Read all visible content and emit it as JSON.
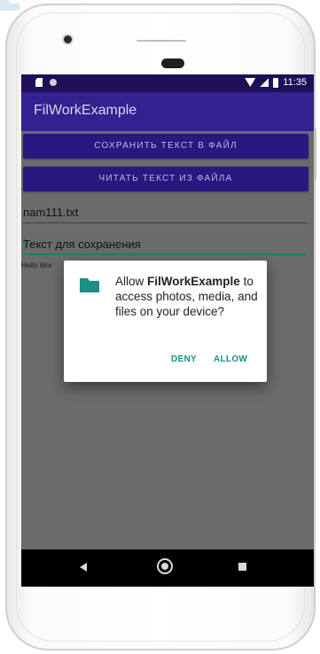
{
  "status_bar": {
    "time": "11:35"
  },
  "app": {
    "title": "FilWorkExample"
  },
  "buttons": {
    "save_to_file": "СОХРАНИТЬ ТЕКСТ В ФАЙЛ",
    "read_from_file": "ЧИТАТЬ ТЕКСТ ИЗ ФАЙЛА"
  },
  "fields": {
    "filename_value": "nam111.txt",
    "text_value": "Текст для сохранения"
  },
  "hello_text": "Hello Wor",
  "permission_dialog": {
    "message_prefix": "Allow ",
    "app_name": "FilWorkExample",
    "message_suffix": " to access photos, media, and files on your device?",
    "deny_label": "DENY",
    "allow_label": "ALLOW"
  },
  "icons": {
    "folder": "folder-icon",
    "nav_back": "back-triangle-icon",
    "nav_home": "home-circle-icon",
    "nav_recents": "recents-square-icon"
  },
  "colors": {
    "status_bar": "#1f0f57",
    "app_bar": "#35208f",
    "buttons": "#2a1880",
    "accent": "#1a8f85"
  }
}
